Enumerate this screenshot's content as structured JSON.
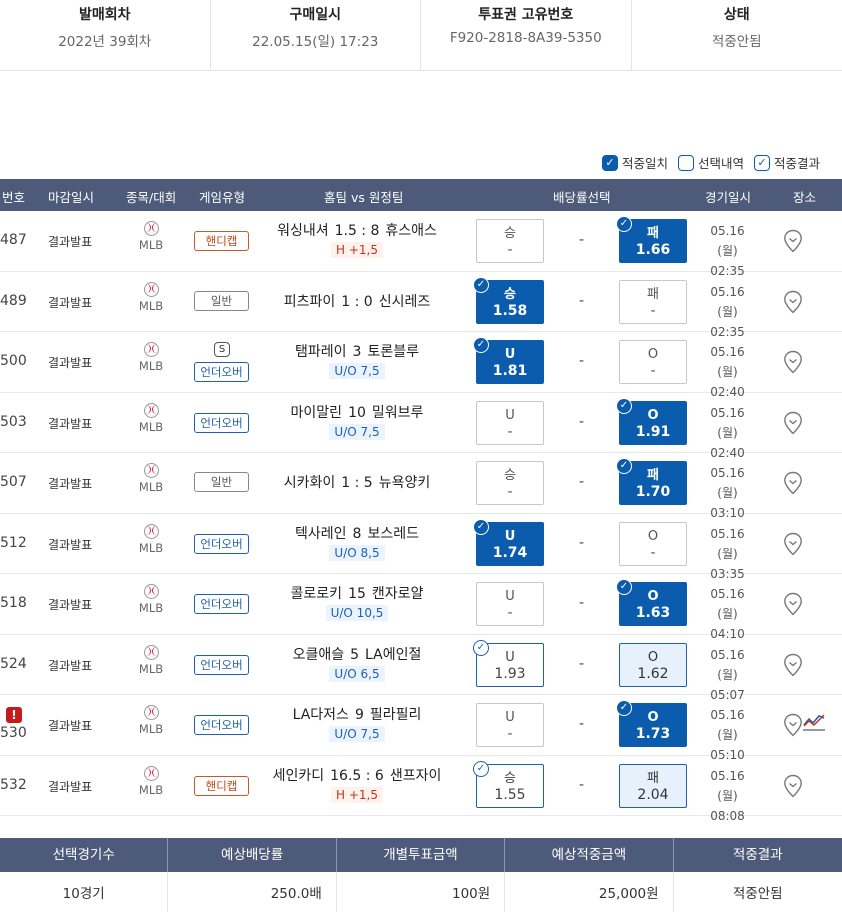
{
  "info": [
    {
      "label": "발매회차",
      "value": "2022년 39회차"
    },
    {
      "label": "구매일시",
      "value": "22.05.15(일) 17:23"
    },
    {
      "label": "투표권 고유번호",
      "value": "F920-2818-8A39-5350"
    },
    {
      "label": "상태",
      "value": "적중안됨"
    }
  ],
  "filters": [
    {
      "label": "적중일치",
      "checked": true
    },
    {
      "label": "선택내역",
      "checked": false
    },
    {
      "label": "적중결과",
      "checked": true
    }
  ],
  "headers": {
    "no": "번호",
    "deadline": "마감일시",
    "sport": "종목/대회",
    "gametype": "게임유형",
    "teams": "홈팀 vs 원정팀",
    "odds": "배당률선택",
    "date": "경기일시",
    "venue": "장소"
  },
  "rows": [
    {
      "no": "487",
      "deadline": "결과발표",
      "league": "MLB",
      "type": "핸디캡",
      "home": "워싱내셔",
      "score": "1.5 : 8",
      "away": "휴스애스",
      "tag": "H +1,5",
      "left_label": "승",
      "left_odds": "-",
      "right_label": "패",
      "right_odds": "1.66",
      "date": "05.16 (월)",
      "time": "02:35"
    },
    {
      "no": "489",
      "deadline": "결과발표",
      "league": "MLB",
      "type": "일반",
      "home": "피츠파이",
      "score": "1 : 0",
      "away": "신시레즈",
      "tag": "",
      "left_label": "승",
      "left_odds": "1.58",
      "right_label": "패",
      "right_odds": "-",
      "date": "05.16 (월)",
      "time": "02:35"
    },
    {
      "no": "500",
      "deadline": "결과발표",
      "league": "MLB",
      "type": "언더오버",
      "sbadge": "S",
      "home": "탬파레이",
      "score": "3",
      "away": "토론블루",
      "tag": "U/O 7,5",
      "left_label": "U",
      "left_odds": "1.81",
      "right_label": "O",
      "right_odds": "-",
      "date": "05.16 (월)",
      "time": "02:40"
    },
    {
      "no": "503",
      "deadline": "결과발표",
      "league": "MLB",
      "type": "언더오버",
      "home": "마이말린",
      "score": "10",
      "away": "밀워브루",
      "tag": "U/O 7,5",
      "left_label": "U",
      "left_odds": "-",
      "right_label": "O",
      "right_odds": "1.91",
      "date": "05.16 (월)",
      "time": "02:40"
    },
    {
      "no": "507",
      "deadline": "결과발표",
      "league": "MLB",
      "type": "일반",
      "home": "시카화이",
      "score": "1 : 5",
      "away": "뉴욕양키",
      "tag": "",
      "left_label": "승",
      "left_odds": "-",
      "right_label": "패",
      "right_odds": "1.70",
      "date": "05.16 (월)",
      "time": "03:10"
    },
    {
      "no": "512",
      "deadline": "결과발표",
      "league": "MLB",
      "type": "언더오버",
      "home": "텍사레인",
      "score": "8",
      "away": "보스레드",
      "tag": "U/O 8,5",
      "left_label": "U",
      "left_odds": "1.74",
      "right_label": "O",
      "right_odds": "-",
      "date": "05.16 (월)",
      "time": "03:35"
    },
    {
      "no": "518",
      "deadline": "결과발표",
      "league": "MLB",
      "type": "언더오버",
      "home": "콜로로키",
      "score": "15",
      "away": "캔자로얄",
      "tag": "U/O 10,5",
      "left_label": "U",
      "left_odds": "-",
      "right_label": "O",
      "right_odds": "1.63",
      "date": "05.16 (월)",
      "time": "04:10"
    },
    {
      "no": "524",
      "deadline": "결과발표",
      "league": "MLB",
      "type": "언더오버",
      "home": "오클애슬",
      "score": "5",
      "away": "LA에인절",
      "tag": "U/O 6,5",
      "left_label": "U",
      "left_odds": "1.93",
      "right_label": "O",
      "right_odds": "1.62",
      "date": "05.16 (월)",
      "time": "05:07"
    },
    {
      "no": "530",
      "deadline": "결과발표",
      "league": "MLB",
      "type": "언더오버",
      "home": "LA다저스",
      "score": "9",
      "away": "필라필리",
      "tag": "U/O 7,5",
      "left_label": "U",
      "left_odds": "-",
      "right_label": "O",
      "right_odds": "1.73",
      "date": "05.16 (월)",
      "time": "05:10",
      "alert": "!"
    },
    {
      "no": "532",
      "deadline": "결과발표",
      "league": "MLB",
      "type": "핸디캡",
      "home": "세인카디",
      "score": "16.5 : 6",
      "away": "샌프자이",
      "tag": "H +1,5",
      "left_label": "승",
      "left_odds": "1.55",
      "right_label": "패",
      "right_odds": "2.04",
      "date": "05.16 (월)",
      "time": "08:08"
    }
  ],
  "dash": "-",
  "summary": {
    "headers": [
      "선택경기수",
      "예상배당률",
      "개별투표금액",
      "예상적중금액",
      "적중결과"
    ],
    "values": [
      "10경기",
      "250.0배",
      "100원",
      "25,000원",
      "적중안됨"
    ]
  }
}
